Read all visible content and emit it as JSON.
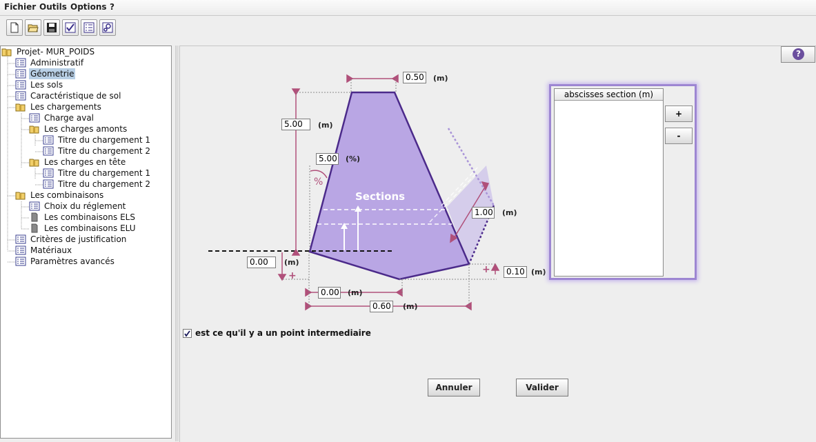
{
  "menu": [
    "Fichier",
    "Outils",
    "Options",
    "?"
  ],
  "toolbar": [
    "new-file-icon",
    "open-folder-icon",
    "save-disk-icon",
    "check-icon",
    "list-icon",
    "settings-icon"
  ],
  "tree": {
    "root": "Projet- MUR_POIDS",
    "items": [
      "Administratif",
      "Géometrie",
      "Les sols",
      "Caractéristique de sol",
      "Les chargements",
      "Charge aval",
      "Les charges amonts",
      "Titre du chargement 1",
      "Titre du chargement 2",
      "Les charges en tête",
      "Titre du chargement 1",
      "Titre du chargement 2",
      "Les combinaisons",
      "Choix du réglement",
      "Les combinaisons ELS",
      "Les combinaisons ELU",
      "Critères de justification",
      "Matériaux",
      "Paramètres avancés"
    ],
    "selected": "Géometrie"
  },
  "geometry": {
    "top_width": "0.50",
    "height": "5.00",
    "batter": "5.00",
    "base_offset": "0.00",
    "heel_rise": "0.10",
    "section_thickness": "1.00",
    "toe_width": "0.00",
    "base_width": "0.60",
    "unit_m": "(m)",
    "unit_pct": "(%)",
    "sections_label": "Sections",
    "pct_symbol": "%",
    "plus": "+"
  },
  "sections_table": {
    "header": "abscisses section (m)",
    "add": "+",
    "remove": "-"
  },
  "intermediate_point": {
    "checked": true,
    "label": "est ce qu'il y a un point intermediaire"
  },
  "actions": {
    "cancel": "Annuler",
    "validate": "Valider"
  },
  "colors": {
    "wall_fill": "#b9a6e4",
    "wall_stroke": "#4b2a8a",
    "dimension": "#b0507a",
    "selection": "#b8cfe5"
  }
}
